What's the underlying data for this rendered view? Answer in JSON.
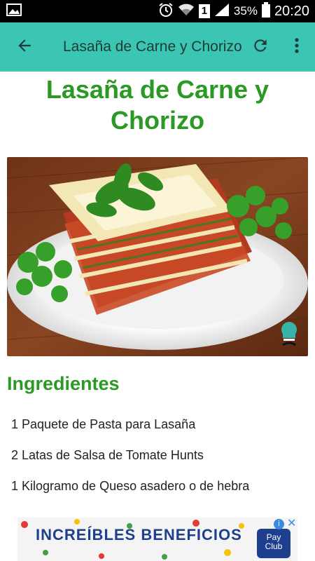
{
  "status_bar": {
    "icons": [
      "image-icon",
      "alarm-icon",
      "wifi-icon",
      "sim-icon",
      "signal-icon",
      "battery-icon"
    ],
    "sim_label": "1",
    "battery_percent": "35%",
    "time": "20:20"
  },
  "toolbar": {
    "title": "Lasaña de Carne y Chorizo",
    "back_icon": "arrow-back-icon",
    "refresh_icon": "refresh-icon",
    "menu_icon": "more-vert-icon",
    "background_color": "#3ac6b2"
  },
  "recipe": {
    "title": "Lasaña de Carne y Chorizo",
    "image_alt": "photo of lasagna on a plate",
    "ingredients_heading": "Ingredientes",
    "ingredients": [
      "1 Paquete de Pasta para Lasaña",
      "2 Latas de Salsa de Tomate Hunts",
      "1 Kilogramo de Queso asadero o de hebra"
    ],
    "accent_color": "#2a9a24"
  },
  "ad": {
    "text": "INCREÍBLES BENEFICIOS",
    "logo_text": "Pay Club",
    "info_icon": "info-icon",
    "close_icon": "close-icon"
  }
}
